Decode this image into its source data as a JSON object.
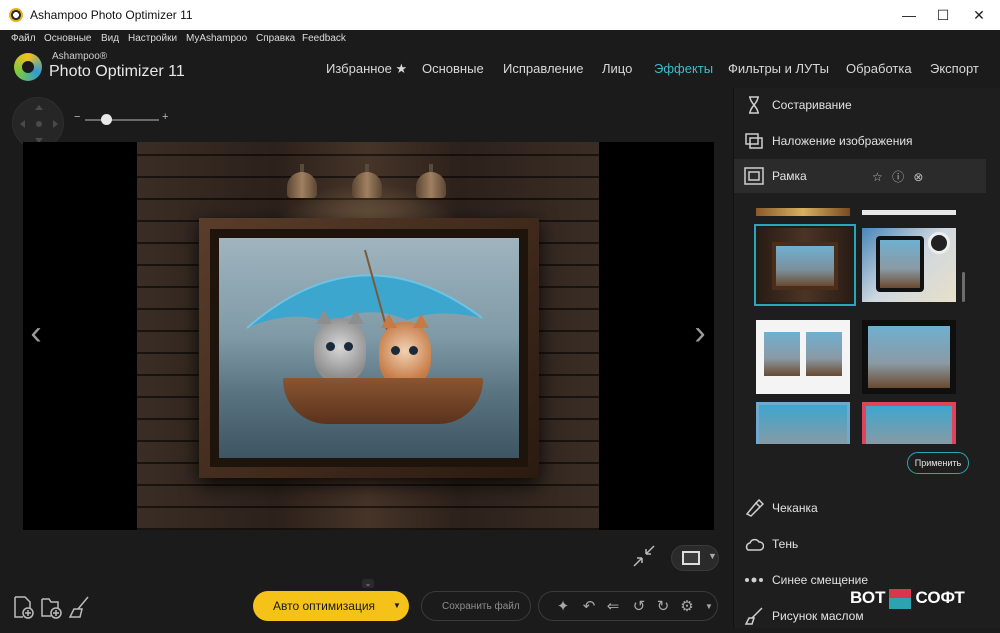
{
  "window": {
    "title": "Ashampoo Photo Optimizer 11",
    "minimize": "—",
    "maximize": "☐",
    "close": "✕"
  },
  "menu": [
    "Файл",
    "Основные",
    "Вид",
    "Настройки",
    "MyAshampoo",
    "Справка",
    "Feedback"
  ],
  "brand": {
    "sub": "Ashampoo®",
    "main": "Photo Optimizer 11"
  },
  "tabs": [
    {
      "label": "Избранное ★",
      "active": false
    },
    {
      "label": "Основные",
      "active": false
    },
    {
      "label": "Исправление",
      "active": false
    },
    {
      "label": "Лицо",
      "active": false
    },
    {
      "label": "Эффекты",
      "active": true
    },
    {
      "label": "Фильтры и ЛУТы",
      "active": false
    },
    {
      "label": "Обработка",
      "active": false
    },
    {
      "label": "Экспорт",
      "active": false
    }
  ],
  "zoom": {
    "minus": "−",
    "plus": "+",
    "level": 0.28
  },
  "viewer": {
    "prev": "‹",
    "next": "›"
  },
  "panel": {
    "items_top": [
      {
        "label": "Состаривание",
        "icon": "hourglass-icon"
      },
      {
        "label": "Наложение изображения",
        "icon": "image-overlay-icon"
      },
      {
        "label": "Рамка",
        "icon": "frame-icon"
      }
    ],
    "frame_actions": "☆ ⓘ ⊗",
    "apply": "Применить",
    "items_bottom": [
      {
        "label": "Чеканка",
        "icon": "emboss-icon"
      },
      {
        "label": "Тень",
        "icon": "cloud-shadow-icon"
      },
      {
        "label": "Синее смещение",
        "icon": "dots-icon"
      },
      {
        "label": "Рисунок маслом",
        "icon": "brush-icon"
      }
    ]
  },
  "bottom": {
    "auto": "Авто оптимизация",
    "auto_caret": "▼",
    "save": "Сохранить файл",
    "collapse": "⌄"
  },
  "watermark": {
    "left": "ВОТ",
    "right": "СОФТ"
  },
  "colors": {
    "accent": "#3dbccf",
    "auto_button": "#f5c21a",
    "panel_bg": "#1e1e1e",
    "app_bg": "#1b1b1b"
  }
}
